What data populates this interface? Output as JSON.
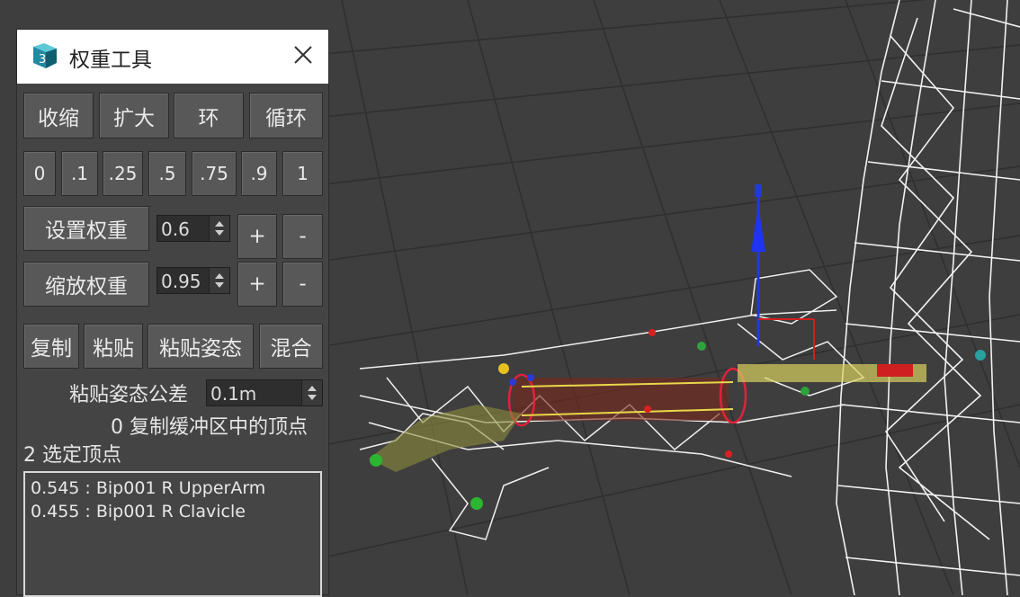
{
  "window": {
    "title": "权重工具"
  },
  "row1": [
    "收缩",
    "扩大",
    "环",
    "循环"
  ],
  "presets": [
    "0",
    ".1",
    ".25",
    ".5",
    ".75",
    ".9",
    "1"
  ],
  "set_weight": {
    "label": "设置权重",
    "value": "0.6",
    "plus": "+",
    "minus": "-"
  },
  "scale_weight": {
    "label": "缩放权重",
    "value": "0.95",
    "plus": "+",
    "minus": "-"
  },
  "row4": [
    "复制",
    "粘贴",
    "粘贴姿态",
    "混合"
  ],
  "tolerance": {
    "label": "粘贴姿态公差",
    "value": "0.1m"
  },
  "buffer_text": "0 复制缓冲区中的顶点",
  "selected_text": "2 选定顶点",
  "weights": [
    "0.545 : Bip001 R UpperArm",
    "0.455 : Bip001 R Clavicle"
  ]
}
